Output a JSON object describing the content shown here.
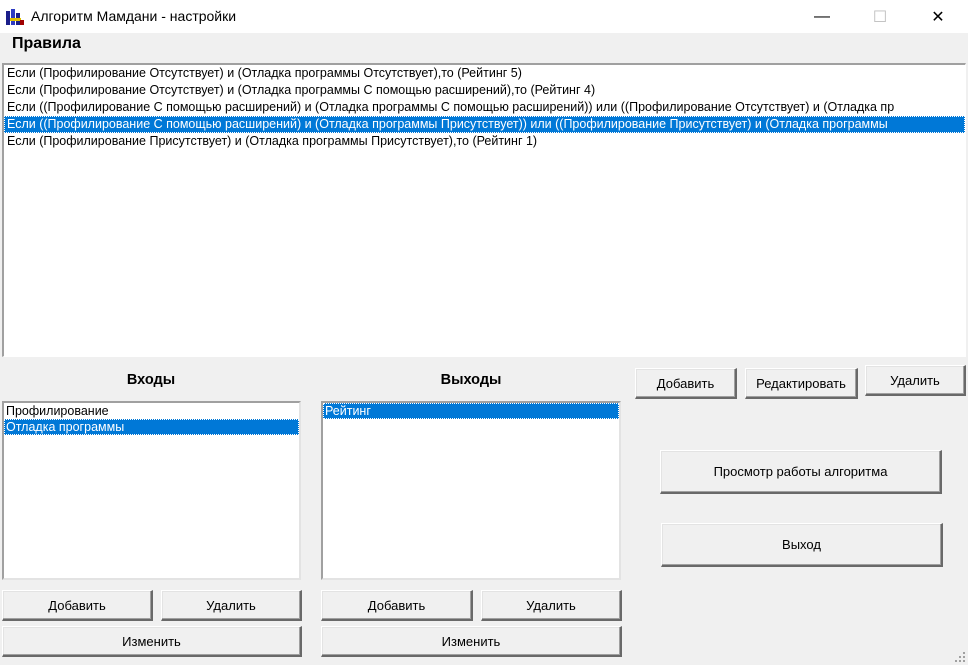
{
  "window": {
    "title": "Алгоритм Мамдани - настройки",
    "minimize_glyph": "—",
    "maximize_glyph": "☐",
    "close_glyph": "✕"
  },
  "rules": {
    "label": "Правила",
    "items": [
      "Если (Профилирование Отсутствует) и (Отладка программы Отсутствует),то (Рейтинг 5)",
      "Если (Профилирование Отсутствует) и (Отладка программы С помощью расширений),то (Рейтинг 4)",
      "Если ((Профилирование С помощью расширений) и (Отладка программы С помощью расширений)) или ((Профилирование Отсутствует) и (Отладка пр",
      "Если ((Профилирование С помощью расширений) и (Отладка программы Присутствует)) или ((Профилирование Присутствует) и (Отладка программы",
      "Если (Профилирование Присутствует) и (Отладка программы Присутствует),то (Рейтинг 1)"
    ],
    "selected_index": 3
  },
  "rule_buttons": {
    "add": "Добавить",
    "edit": "Редактировать",
    "delete": "Удалить"
  },
  "inputs": {
    "label": "Входы",
    "items": [
      "Профилирование",
      "Отладка программы"
    ],
    "selected_index": 1,
    "add": "Добавить",
    "delete": "Удалить",
    "change": "Изменить"
  },
  "outputs": {
    "label": "Выходы",
    "items": [
      "Рейтинг"
    ],
    "selected_index": 0,
    "add": "Добавить",
    "delete": "Удалить",
    "change": "Изменить"
  },
  "actions": {
    "view": "Просмотр работы алгоритма",
    "exit": "Выход"
  },
  "icons": {
    "app": "app-icon",
    "grip": "size-grip-icon"
  },
  "colors": {
    "selection": "#0078d7",
    "face": "#f0f0f0"
  }
}
